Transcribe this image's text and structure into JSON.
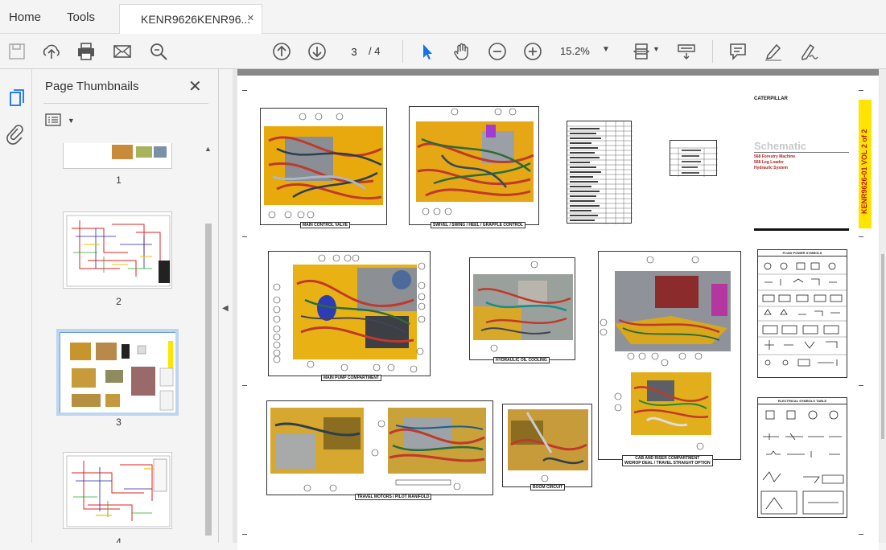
{
  "menu": {
    "home": "Home",
    "tools": "Tools"
  },
  "tab": {
    "title": "KENR9626KENR96...",
    "close": "×"
  },
  "toolbar": {
    "page_current": "3",
    "page_total": "/ 4",
    "zoom": "15.2%",
    "icons": [
      "save-icon",
      "cloud-upload-icon",
      "print-icon",
      "mail-icon",
      "search-zoom-icon",
      "arrow-up-circle-icon",
      "arrow-down-circle-icon",
      "select-pointer-icon",
      "hand-icon",
      "zoom-out-icon",
      "zoom-in-icon",
      "page-fit-icon",
      "scroll-mode-icon",
      "comment-icon",
      "highlight-pen-icon",
      "sign-icon"
    ]
  },
  "panel": {
    "title": "Page Thumbnails",
    "close": "✕",
    "thumbs": [
      {
        "label": "1"
      },
      {
        "label": "2"
      },
      {
        "label": "3",
        "selected": true
      },
      {
        "label": "4"
      }
    ]
  },
  "document": {
    "captions": {
      "c1": "MAIN CONTROL VALVE",
      "c2": "SWIVEL / SWING / HEEL / GRAPPLE CONTROL",
      "c3": "MAIN PUMP COMPARTMENT",
      "c4": "HYDRAULIC OIL COOLING",
      "c5": "CAB AND RISER COMPARTMENT",
      "c5b": "W/DROP DEAL / TRAVEL STRAIGHT OPTION",
      "c6": "TRAVEL MOTORS / PILOT MANIFOLD",
      "c7": "BOOM CIRCUIT"
    },
    "logo": "CATERPILLAR",
    "schematic_title": "Schematic",
    "schematic_lines": [
      "568 Forestry Machine",
      "568 Log Loader",
      "Hydraulic System"
    ],
    "side_title": "KENR9626-01 VOL 2 of 2",
    "fluid_power_title": "FLUID POWER SYMBOLS",
    "electrical_title": "ELECTRICAL SYMBOLS TABLE"
  },
  "colors": {
    "accent": "#1473e6",
    "yellow": "#ffe400",
    "selected_thumb": "#bcd6f0"
  }
}
